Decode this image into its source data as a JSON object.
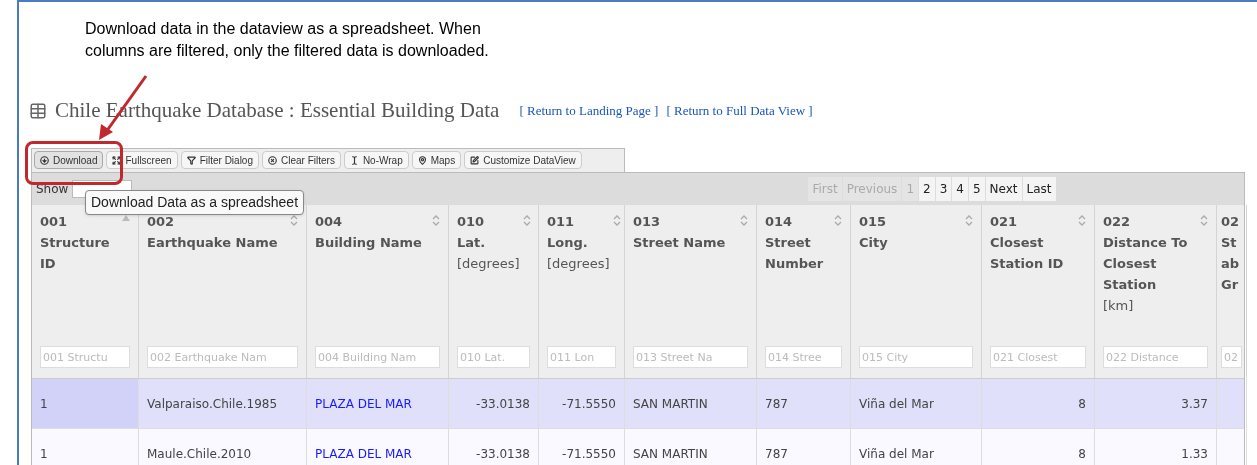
{
  "annotation": {
    "text": "Download data in the dataview as a spreadsheet. When columns are filtered, only the filtered data is downloaded."
  },
  "title": "Chile Earthquake Database : Essential Building Data",
  "links": [
    "[ Return to Landing Page ]",
    "[ Return to Full Data View ]"
  ],
  "toolbar": [
    {
      "label": "Download",
      "highlighted": true
    },
    {
      "label": "Fullscreen",
      "highlighted": false
    },
    {
      "label": "Filter Dialog",
      "highlighted": false
    },
    {
      "label": "Clear Filters",
      "highlighted": false
    },
    {
      "label": "No-Wrap",
      "highlighted": false
    },
    {
      "label": "Maps",
      "highlighted": false
    },
    {
      "label": "Customize DataView",
      "highlighted": false
    }
  ],
  "tooltip": "Download Data as a spreadsheet",
  "show_label": "Show",
  "pagination": [
    {
      "label": "First",
      "disabled": true
    },
    {
      "label": "Previous",
      "disabled": true
    },
    {
      "label": "1",
      "disabled": true
    },
    {
      "label": "2",
      "disabled": false
    },
    {
      "label": "3",
      "disabled": false
    },
    {
      "label": "4",
      "disabled": false
    },
    {
      "label": "5",
      "disabled": false
    },
    {
      "label": "Next",
      "disabled": false
    },
    {
      "label": "Last",
      "disabled": false
    }
  ],
  "columns": [
    {
      "number": "001",
      "title": [
        "Structure",
        "ID"
      ],
      "sorted": true,
      "placeholder": "001 Structu",
      "kind": "text"
    },
    {
      "number": "002",
      "title": [
        "Earthquake Name"
      ],
      "sorted": false,
      "placeholder": "002 Earthquake Nam",
      "kind": "text"
    },
    {
      "number": "004",
      "title": [
        "Building Name"
      ],
      "sorted": false,
      "placeholder": "004 Building Nam",
      "kind": "link"
    },
    {
      "number": "010",
      "title": [
        "Lat."
      ],
      "unit": "[degrees]",
      "sorted": false,
      "placeholder": "010 Lat.",
      "kind": "number"
    },
    {
      "number": "011",
      "title": [
        "Long."
      ],
      "unit": "[degrees]",
      "sorted": false,
      "placeholder": "011 Lon",
      "kind": "number"
    },
    {
      "number": "013",
      "title": [
        "Street Name"
      ],
      "sorted": false,
      "placeholder": "013 Street Na",
      "kind": "text"
    },
    {
      "number": "014",
      "title": [
        "Street",
        "Number"
      ],
      "sorted": false,
      "placeholder": "014 Stree",
      "kind": "text"
    },
    {
      "number": "015",
      "title": [
        "City"
      ],
      "sorted": false,
      "placeholder": "015 City",
      "kind": "text"
    },
    {
      "number": "021",
      "title": [
        "Closest",
        "Station ID"
      ],
      "sorted": false,
      "placeholder": "021 Closest",
      "kind": "number"
    },
    {
      "number": "022",
      "title": [
        "Distance To",
        "Closest",
        "Station"
      ],
      "unit": "[km]",
      "sorted": false,
      "placeholder": "022 Distance",
      "kind": "number"
    },
    {
      "number": "02",
      "title": [
        "St",
        "ab",
        "Gr"
      ],
      "placeholder": "02",
      "kind": "text"
    }
  ],
  "rows": [
    {
      "selected": true,
      "cells": [
        "1",
        "Valparaiso.Chile.1985",
        "PLAZA DEL MAR",
        "-33.0138",
        "-71.5550",
        "SAN MARTIN",
        "787",
        "Viña del Mar",
        "8",
        "3.37"
      ]
    },
    {
      "selected": false,
      "cells": [
        "1",
        "Maule.Chile.2010",
        "PLAZA DEL MAR",
        "-33.0138",
        "-71.5550",
        "SAN MARTIN",
        "787",
        "Viña del Mar",
        "8",
        "1.33"
      ]
    }
  ]
}
